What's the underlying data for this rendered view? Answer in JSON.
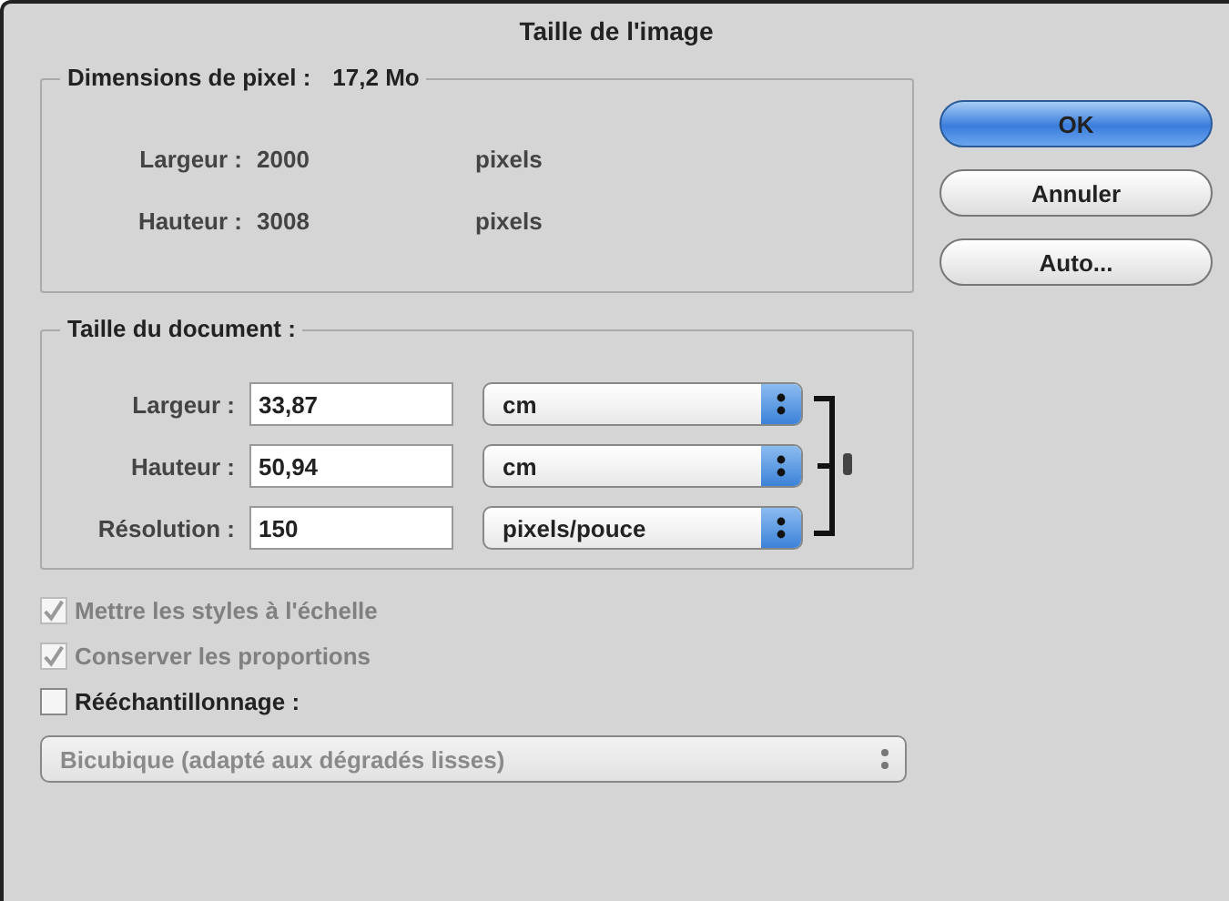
{
  "window": {
    "title": "Taille de l'image"
  },
  "pixel_dimensions": {
    "legend": "Dimensions de pixel :",
    "size": "17,2 Mo",
    "rows": [
      {
        "label": "Largeur :",
        "value": "2000",
        "unit": "pixels"
      },
      {
        "label": "Hauteur :",
        "value": "3008",
        "unit": "pixels"
      }
    ]
  },
  "document_size": {
    "legend": "Taille du document :",
    "rows": [
      {
        "label": "Largeur :",
        "value": "33,87",
        "unit": "cm"
      },
      {
        "label": "Hauteur :",
        "value": "50,94",
        "unit": "cm"
      },
      {
        "label": "Résolution :",
        "value": "150",
        "unit": "pixels/pouce"
      }
    ]
  },
  "options": [
    {
      "label": "Mettre les styles à l'échelle",
      "checked": true,
      "disabled": true
    },
    {
      "label": "Conserver les proportions",
      "checked": true,
      "disabled": true
    },
    {
      "label": "Rééchantillonnage :",
      "checked": false,
      "disabled": false
    }
  ],
  "method": {
    "value": "Bicubique (adapté aux dégradés lisses)",
    "disabled": true
  },
  "buttons": [
    {
      "label": "OK",
      "default": true
    },
    {
      "label": "Annuler",
      "default": false
    },
    {
      "label": "Auto...",
      "default": false
    }
  ]
}
